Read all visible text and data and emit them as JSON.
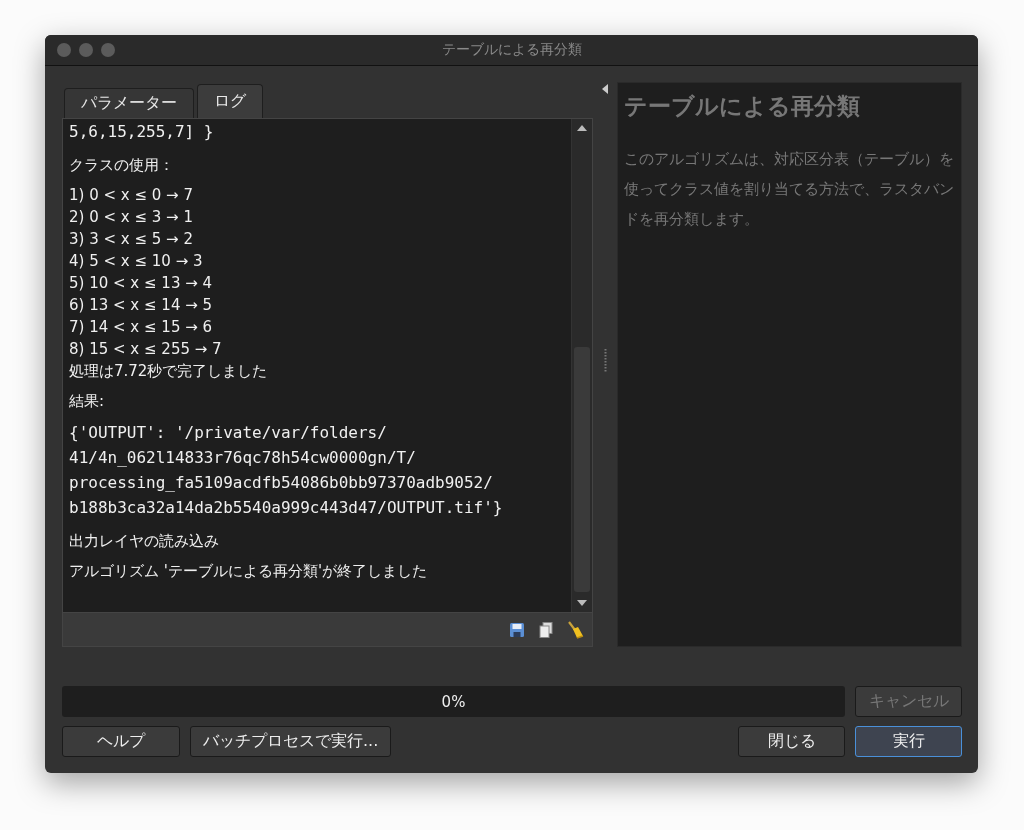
{
  "window": {
    "title": "テーブルによる再分類"
  },
  "tabs": [
    {
      "label": "パラメーター",
      "selected": false
    },
    {
      "label": "ログ",
      "selected": true
    }
  ],
  "log": [
    {
      "kind": "mono",
      "lines": [
        "5,6,15,255,7] }"
      ]
    },
    {
      "kind": "gap"
    },
    {
      "kind": "text",
      "lines": [
        "クラスの使用："
      ]
    },
    {
      "kind": "text",
      "lines": [
        "1) 0 < x ≤ 0 → 7",
        "2) 0 < x ≤ 3 → 1",
        "3) 3 < x ≤ 5 → 2",
        "4) 5 < x ≤ 10 → 3",
        "5) 10 < x ≤ 13 → 4",
        "6) 13 < x ≤ 14 → 5",
        "7) 14 < x ≤ 15 → 6",
        "8) 15 < x ≤ 255 → 7",
        "処理は7.72秒で完了しました"
      ]
    },
    {
      "kind": "text",
      "lines": [
        "結果:"
      ]
    },
    {
      "kind": "mono",
      "lines": [
        "{'OUTPUT': '/private/var/folders/",
        "41/4n_062l14833r76qc78h54cw0000gn/T/",
        "processing_fa5109acdfb54086b0bb97370adb9052/",
        "b188b3ca32a14da2b5540a999c443d47/OUTPUT.tif'}"
      ]
    },
    {
      "kind": "gap"
    },
    {
      "kind": "text",
      "lines": [
        "出力レイヤの読み込み"
      ]
    },
    {
      "kind": "text",
      "lines": [
        "アルゴリズム 'テーブルによる再分類'が終了しました"
      ]
    }
  ],
  "help": {
    "title": "テーブルによる再分類",
    "body": "このアルゴリズムは、対応区分表（テーブル）を使ってクラス値を割り当てる方法で、ラスタバンドを再分類します。"
  },
  "progress": {
    "level": 0,
    "text": "0%"
  },
  "cancel": {
    "label": "キャンセル",
    "disabled": true
  },
  "left_buttons": [
    {
      "label": "ヘルプ",
      "default": false
    },
    {
      "label": "バッチプロセスで実行...",
      "default": false
    }
  ],
  "right_buttons": [
    {
      "label": "閉じる",
      "default": false
    },
    {
      "label": "実行",
      "default": true
    }
  ]
}
